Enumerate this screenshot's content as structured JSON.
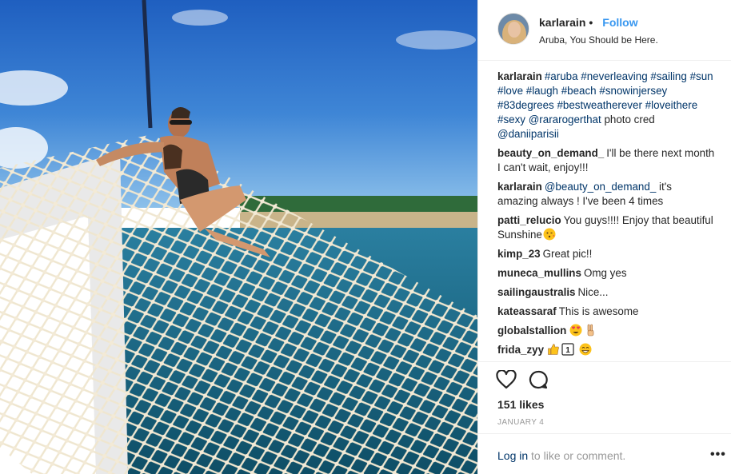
{
  "post": {
    "username": "karlarain",
    "separator": "•",
    "follow_label": "Follow",
    "location": "Aruba, You Should be Here.",
    "caption": {
      "username": "karlarain",
      "parts": [
        {
          "t": "tag",
          "v": "#aruba"
        },
        {
          "t": "txt",
          "v": " "
        },
        {
          "t": "tag",
          "v": "#neverleaving"
        },
        {
          "t": "txt",
          "v": " "
        },
        {
          "t": "tag",
          "v": "#sailing"
        },
        {
          "t": "txt",
          "v": " "
        },
        {
          "t": "tag",
          "v": "#sun"
        },
        {
          "t": "txt",
          "v": " "
        },
        {
          "t": "tag",
          "v": "#love"
        },
        {
          "t": "txt",
          "v": " "
        },
        {
          "t": "tag",
          "v": "#laugh"
        },
        {
          "t": "txt",
          "v": " "
        },
        {
          "t": "tag",
          "v": "#beach"
        },
        {
          "t": "txt",
          "v": " "
        },
        {
          "t": "tag",
          "v": "#snowinjersey"
        },
        {
          "t": "txt",
          "v": " "
        },
        {
          "t": "tag",
          "v": "#83degrees"
        },
        {
          "t": "txt",
          "v": " "
        },
        {
          "t": "tag",
          "v": "#bestweatherever"
        },
        {
          "t": "txt",
          "v": " "
        },
        {
          "t": "tag",
          "v": "#loveithere"
        },
        {
          "t": "txt",
          "v": " "
        },
        {
          "t": "tag",
          "v": "#sexy"
        },
        {
          "t": "txt",
          "v": " "
        },
        {
          "t": "tag",
          "v": "@rararogerthat"
        },
        {
          "t": "txt",
          "v": " photo cred "
        },
        {
          "t": "tag",
          "v": "@daniiparisii"
        }
      ]
    },
    "comments": [
      {
        "user": "beauty_on_demand_",
        "parts": [
          {
            "t": "txt",
            "v": "I'll be there next month I can't wait, enjoy!!!"
          }
        ]
      },
      {
        "user": "karlarain",
        "parts": [
          {
            "t": "tag",
            "v": "@beauty_on_demand_"
          },
          {
            "t": "txt",
            "v": " it's amazing always ! I've been 4 times"
          }
        ]
      },
      {
        "user": "patti_relucio",
        "parts": [
          {
            "t": "txt",
            "v": "You guys!!!! Enjoy that beautiful Sunshine"
          },
          {
            "t": "emoji",
            "v": "kiss-face"
          }
        ]
      },
      {
        "user": "kimp_23",
        "parts": [
          {
            "t": "txt",
            "v": "Great pic!!"
          }
        ]
      },
      {
        "user": "muneca_mullins",
        "parts": [
          {
            "t": "txt",
            "v": "Omg yes"
          }
        ]
      },
      {
        "user": "sailingaustralis",
        "parts": [
          {
            "t": "txt",
            "v": "Nice..."
          }
        ]
      },
      {
        "user": "kateassaraf",
        "parts": [
          {
            "t": "txt",
            "v": "This is awesome"
          }
        ]
      },
      {
        "user": "globalstallion",
        "parts": [
          {
            "t": "emoji",
            "v": "heart-eyes-face"
          },
          {
            "t": "emoji",
            "v": "victory-hand"
          }
        ]
      },
      {
        "user": "frida_zyy",
        "parts": [
          {
            "t": "emoji",
            "v": "thumbs-up"
          },
          {
            "t": "emoji",
            "v": "keycap-1"
          },
          {
            "t": "txt",
            "v": " "
          },
          {
            "t": "emoji",
            "v": "grin-face"
          }
        ]
      }
    ],
    "likes": "151 likes",
    "date": "JANUARY 4",
    "login_link": "Log in",
    "login_rest": " to like or comment.",
    "more_label": "•••",
    "icons": {
      "like": "heart-outline-icon",
      "comment": "speech-bubble-icon",
      "more": "more-options-icon"
    },
    "colors": {
      "link": "#003569",
      "follow": "#3897f0",
      "muted": "#999999",
      "text": "#262626"
    }
  }
}
